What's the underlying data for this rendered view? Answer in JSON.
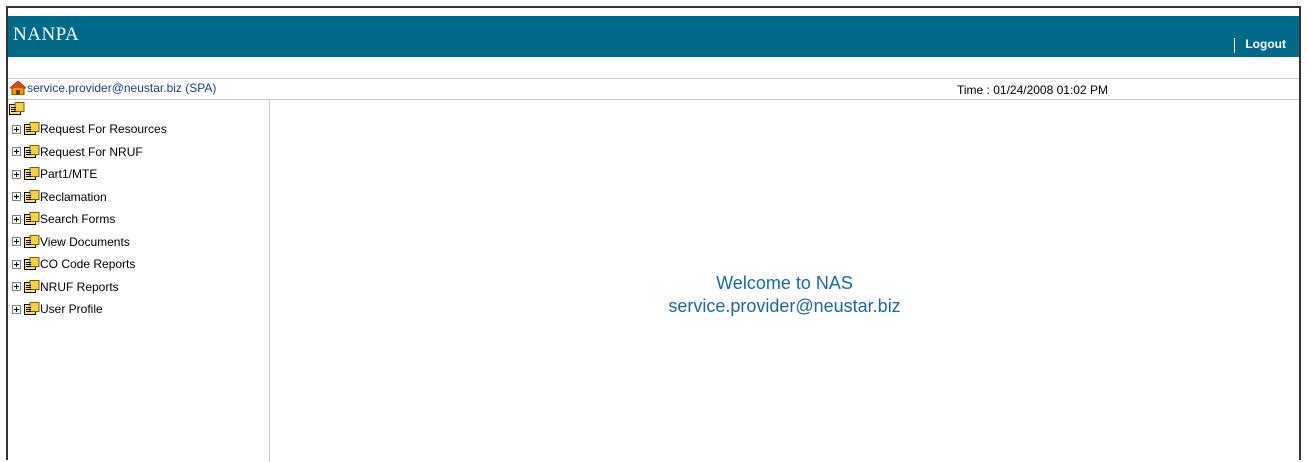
{
  "header": {
    "brand": "NANPA",
    "logout_label": "Logout"
  },
  "infobar": {
    "user": "service.provider@neustar.biz (SPA)",
    "time": "Time : 01/24/2008 01:02 PM"
  },
  "sidebar": {
    "items": [
      {
        "label": "Request For Resources"
      },
      {
        "label": "Request For NRUF"
      },
      {
        "label": "Part1/MTE"
      },
      {
        "label": "Reclamation"
      },
      {
        "label": "Search Forms"
      },
      {
        "label": "View Documents"
      },
      {
        "label": "CO Code Reports"
      },
      {
        "label": "NRUF Reports"
      },
      {
        "label": "User Profile"
      }
    ]
  },
  "main": {
    "welcome_line1": "Welcome to NAS",
    "welcome_line2": "service.provider@neustar.biz"
  },
  "colors": {
    "banner": "#006a8a",
    "welcome_text": "#1a6a96",
    "user_link": "#1c3f7a"
  }
}
